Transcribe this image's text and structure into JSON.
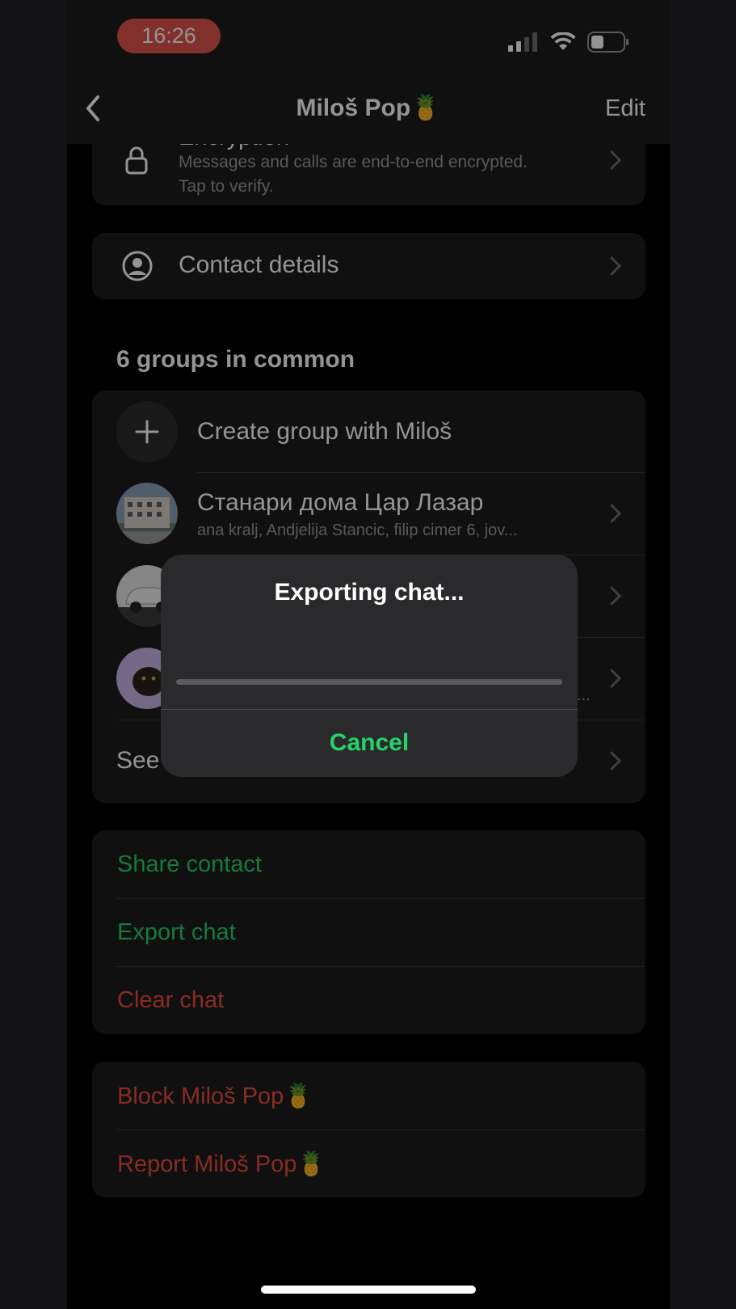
{
  "status_bar": {
    "time": "16:26",
    "battery_level": 0.4
  },
  "nav": {
    "title": "Miloš Pop🍍",
    "edit": "Edit"
  },
  "encryption": {
    "title": "Encryption",
    "description_line1": "Messages and calls are end-to-end encrypted.",
    "description_line2": "Tap to verify."
  },
  "contact_details": {
    "label": "Contact details"
  },
  "groups": {
    "header": "6 groups in common",
    "create_label": "Create group with Miloš",
    "items": [
      {
        "name": "Станари дома Цар Лазар",
        "members": "ana kralj, Andjelija Stancic, filip cimer 6, jov..."
      },
      {
        "name": "",
        "members": ""
      },
      {
        "name": "",
        "members": "..."
      }
    ],
    "see_all": "See"
  },
  "actions": {
    "share": "Share contact",
    "export": "Export chat",
    "clear": "Clear chat",
    "block": "Block Miloš Pop🍍",
    "report": "Report Miloš Pop🍍"
  },
  "dialog": {
    "title": "Exporting chat...",
    "progress": 0,
    "cancel": "Cancel"
  },
  "colors": {
    "accent_green": "#25d366",
    "destructive_red": "#eb4d3d",
    "time_pill": "#e0544b"
  }
}
